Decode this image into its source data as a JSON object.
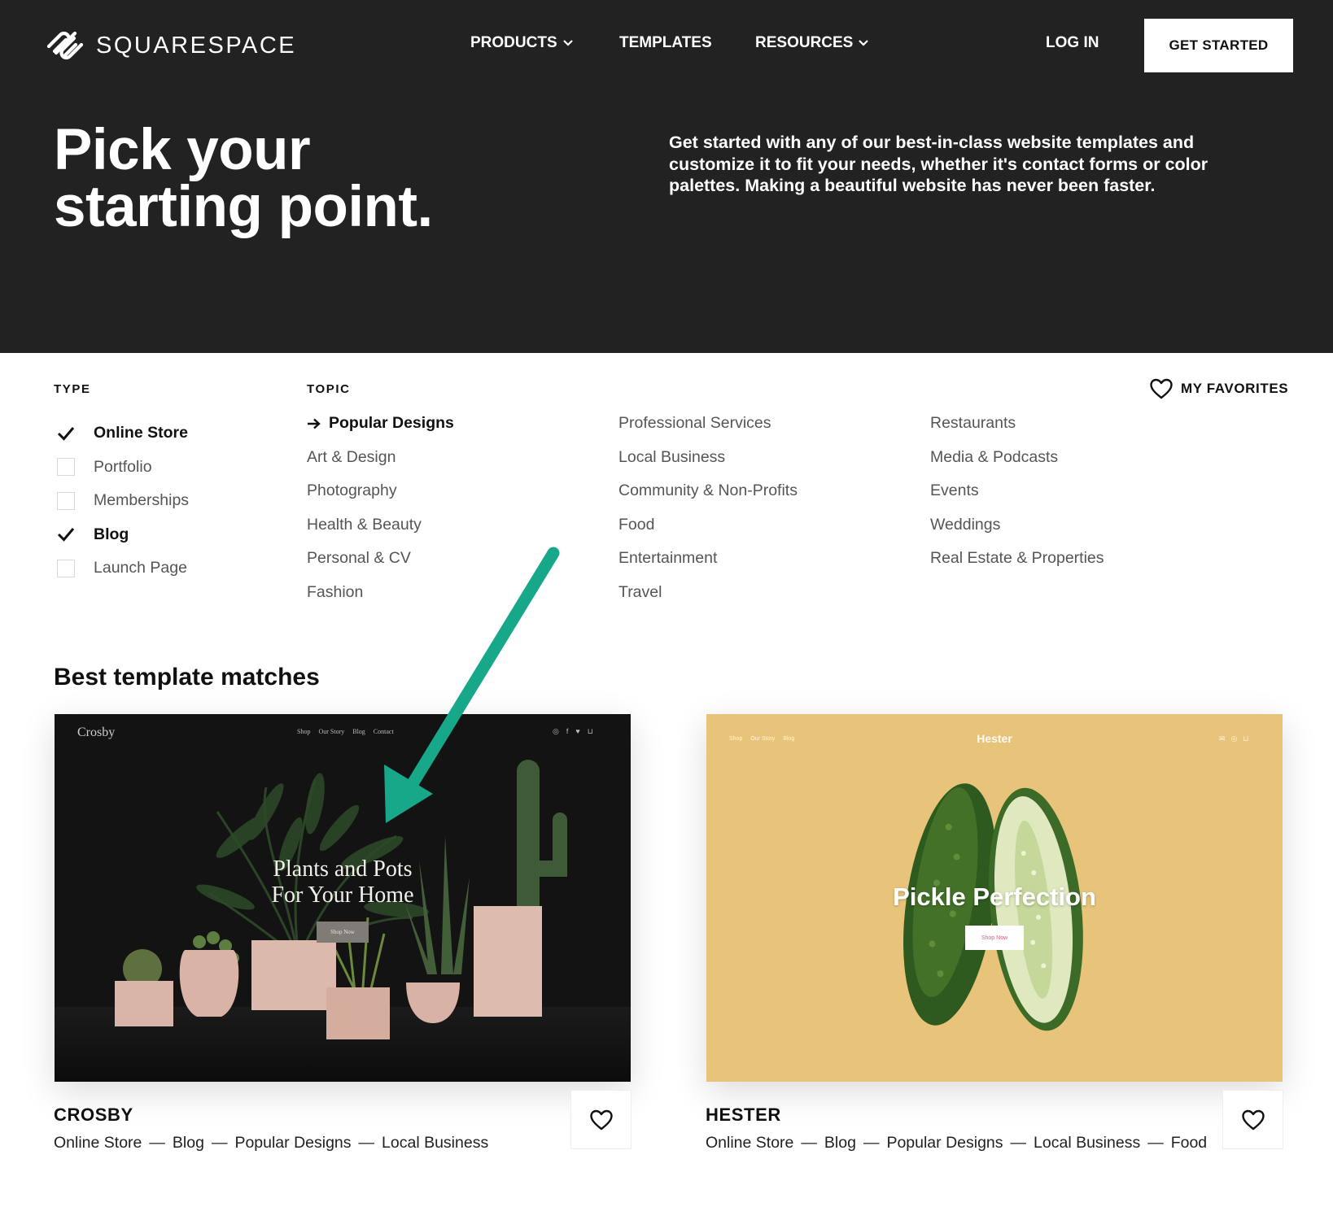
{
  "brand": {
    "name": "SQUARESPACE"
  },
  "nav": {
    "products": "PRODUCTS",
    "templates": "TEMPLATES",
    "resources": "RESOURCES",
    "login": "LOG IN",
    "cta": "GET STARTED"
  },
  "hero": {
    "title_line1": "Pick your",
    "title_line2": "starting point.",
    "description": "Get started with any of our best-in-class website templates and customize it to fit your needs, whether it's contact forms or color palettes. Making a beautiful website has never been faster."
  },
  "filters": {
    "type_heading": "TYPE",
    "topic_heading": "TOPIC",
    "favorites_label": "MY FAVORITES",
    "types": [
      {
        "label": "Online Store",
        "checked": true
      },
      {
        "label": "Portfolio",
        "checked": false
      },
      {
        "label": "Memberships",
        "checked": false
      },
      {
        "label": "Blog",
        "checked": true
      },
      {
        "label": "Launch Page",
        "checked": false
      }
    ],
    "topics_col1": [
      "Popular Designs",
      "Art & Design",
      "Photography",
      "Health & Beauty",
      "Personal & CV",
      "Fashion"
    ],
    "topics_col2": [
      "Professional Services",
      "Local Business",
      "Community & Non-Profits",
      "Food",
      "Entertainment",
      "Travel"
    ],
    "topics_col3": [
      "Restaurants",
      "Media & Podcasts",
      "Events",
      "Weddings",
      "Real Estate & Properties"
    ],
    "active_topic": "Popular Designs"
  },
  "results": {
    "heading": "Best template matches",
    "templates": [
      {
        "name": "CROSBY",
        "tags": [
          "Online Store",
          "Blog",
          "Popular Designs",
          "Local Business"
        ],
        "preview": {
          "brand": "Crosby",
          "links": [
            "Shop",
            "Our Story",
            "Blog",
            "Contact"
          ],
          "headline_line1": "Plants and Pots",
          "headline_line2": "For Your Home",
          "button": "Shop Now"
        }
      },
      {
        "name": "HESTER",
        "tags": [
          "Online Store",
          "Blog",
          "Popular Designs",
          "Local Business",
          "Food"
        ],
        "preview": {
          "brand": "Hester",
          "links": [
            "Shop",
            "Our Story",
            "Blog"
          ],
          "headline": "Pickle Perfection",
          "button": "Shop Now"
        }
      }
    ]
  },
  "colors": {
    "hero_bg": "#222222",
    "annotation_arrow": "#17a88a",
    "hester_bg": "#e8c47a"
  }
}
